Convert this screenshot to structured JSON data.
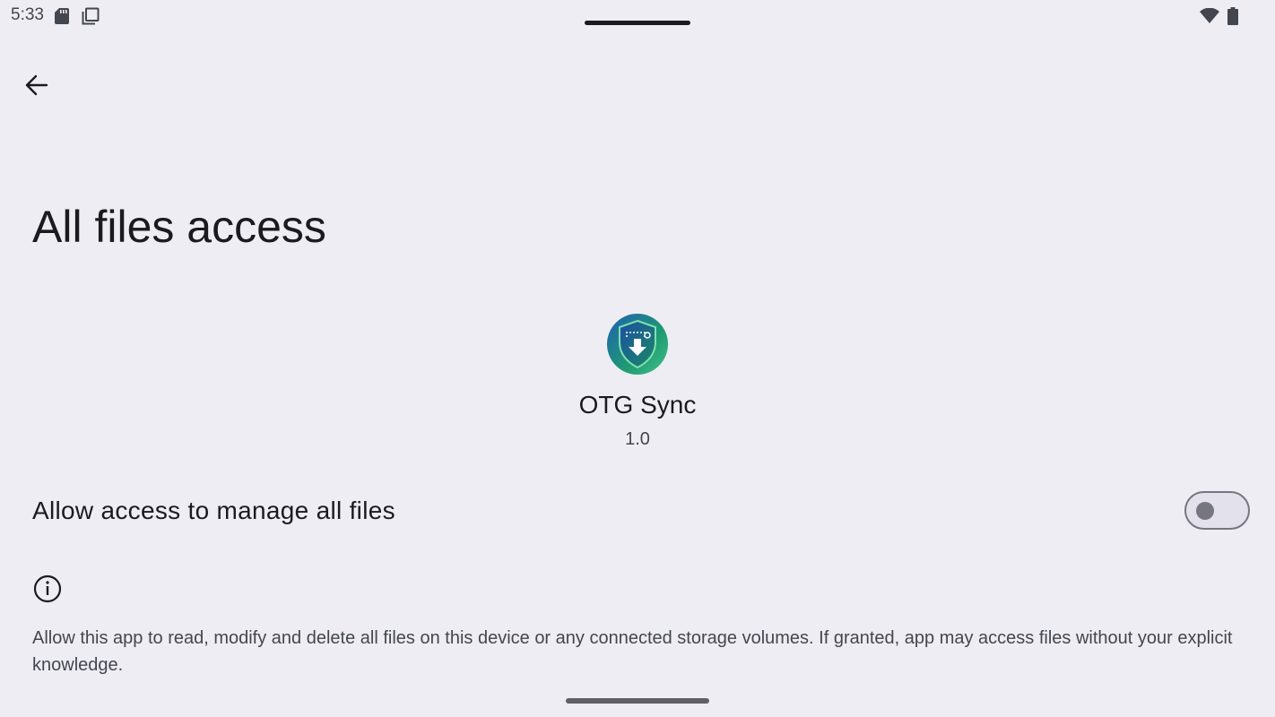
{
  "status_bar": {
    "time": "5:33",
    "icons": [
      "sd-card-icon",
      "copy-icon",
      "wifi-icon",
      "battery-icon"
    ]
  },
  "app_bar": {
    "back_icon": "arrow-back-icon"
  },
  "page": {
    "title": "All files access"
  },
  "app": {
    "name": "OTG Sync",
    "version": "1.0",
    "icon": "otg-sync-app-icon",
    "icon_colors": [
      "#1f5fb4",
      "#1f9a72",
      "#42c28a"
    ]
  },
  "permission": {
    "label": "Allow access to manage all files",
    "enabled": false
  },
  "footer": {
    "icon": "info-icon",
    "text": "Allow this app to read, modify and delete all files on this device or any connected storage volumes. If granted, app may access files without your explicit knowledge."
  },
  "colors": {
    "background": "#eeedf3",
    "text_primary": "#1b1b1f",
    "text_secondary": "#44464f",
    "switch_outline": "#767680"
  }
}
